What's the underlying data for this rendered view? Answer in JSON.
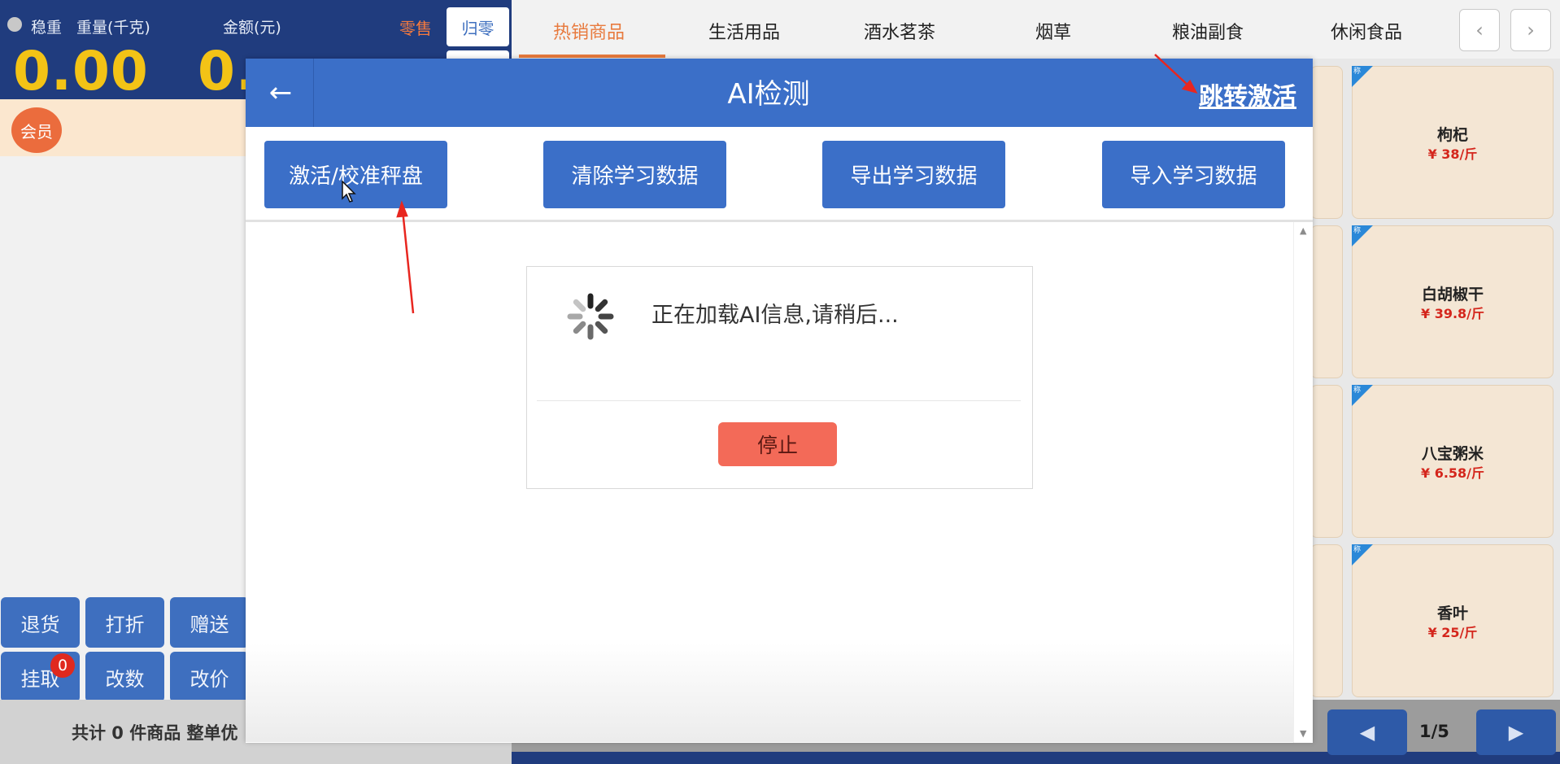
{
  "pos_header": {
    "stable_label": "稳重",
    "weight_label": "重量(千克)",
    "amount_label": "金额(元)",
    "weight_value": "0.00",
    "amount_value": "0.",
    "retail_label": "零售",
    "zero_label": "归零"
  },
  "member": {
    "label": "会员"
  },
  "actions": {
    "return": "退货",
    "discount": "打折",
    "gift": "赠送",
    "hold": "挂取",
    "hold_count": "0",
    "edit_qty": "改数",
    "edit_price": "改价"
  },
  "summary": {
    "text": "共计 0 件商品 整单优"
  },
  "tabs": [
    "热销商品",
    "生活用品",
    "酒水茗茶",
    "烟草",
    "粮油副食",
    "休闲食品"
  ],
  "tab_nav": {
    "prev": "‹",
    "next": "›"
  },
  "products": [
    {
      "name": "枸杞",
      "price": "¥ 38/斤",
      "tag": "称"
    },
    {
      "name": "白胡椒干",
      "price": "¥ 39.8/斤",
      "tag": "称"
    },
    {
      "name": "八宝粥米",
      "price": "¥ 6.58/斤",
      "tag": "称"
    },
    {
      "name": "香叶",
      "price": "¥ 25/斤",
      "tag": "称"
    }
  ],
  "pager": {
    "indicator": "1/5",
    "prev": "◀",
    "next": "▶"
  },
  "modal": {
    "back": "←",
    "title": "AI检测",
    "jump_activate": "跳转激活",
    "buttons": {
      "activate_calibrate": "激活/校准秤盘",
      "clear_learning": "清除学习数据",
      "export_learning": "导出学习数据",
      "import_learning": "导入学习数据"
    },
    "loading_text": "正在加载AI信息,请稍后...",
    "stop_label": "停止",
    "scroll_up": "▲",
    "scroll_down": "▼"
  },
  "colors": {
    "primary_blue": "#3b6fc8",
    "header_navy": "#203c7e",
    "accent_orange": "#e87a3e",
    "stop_red": "#f36a58",
    "annotation_red": "#e8261f"
  }
}
